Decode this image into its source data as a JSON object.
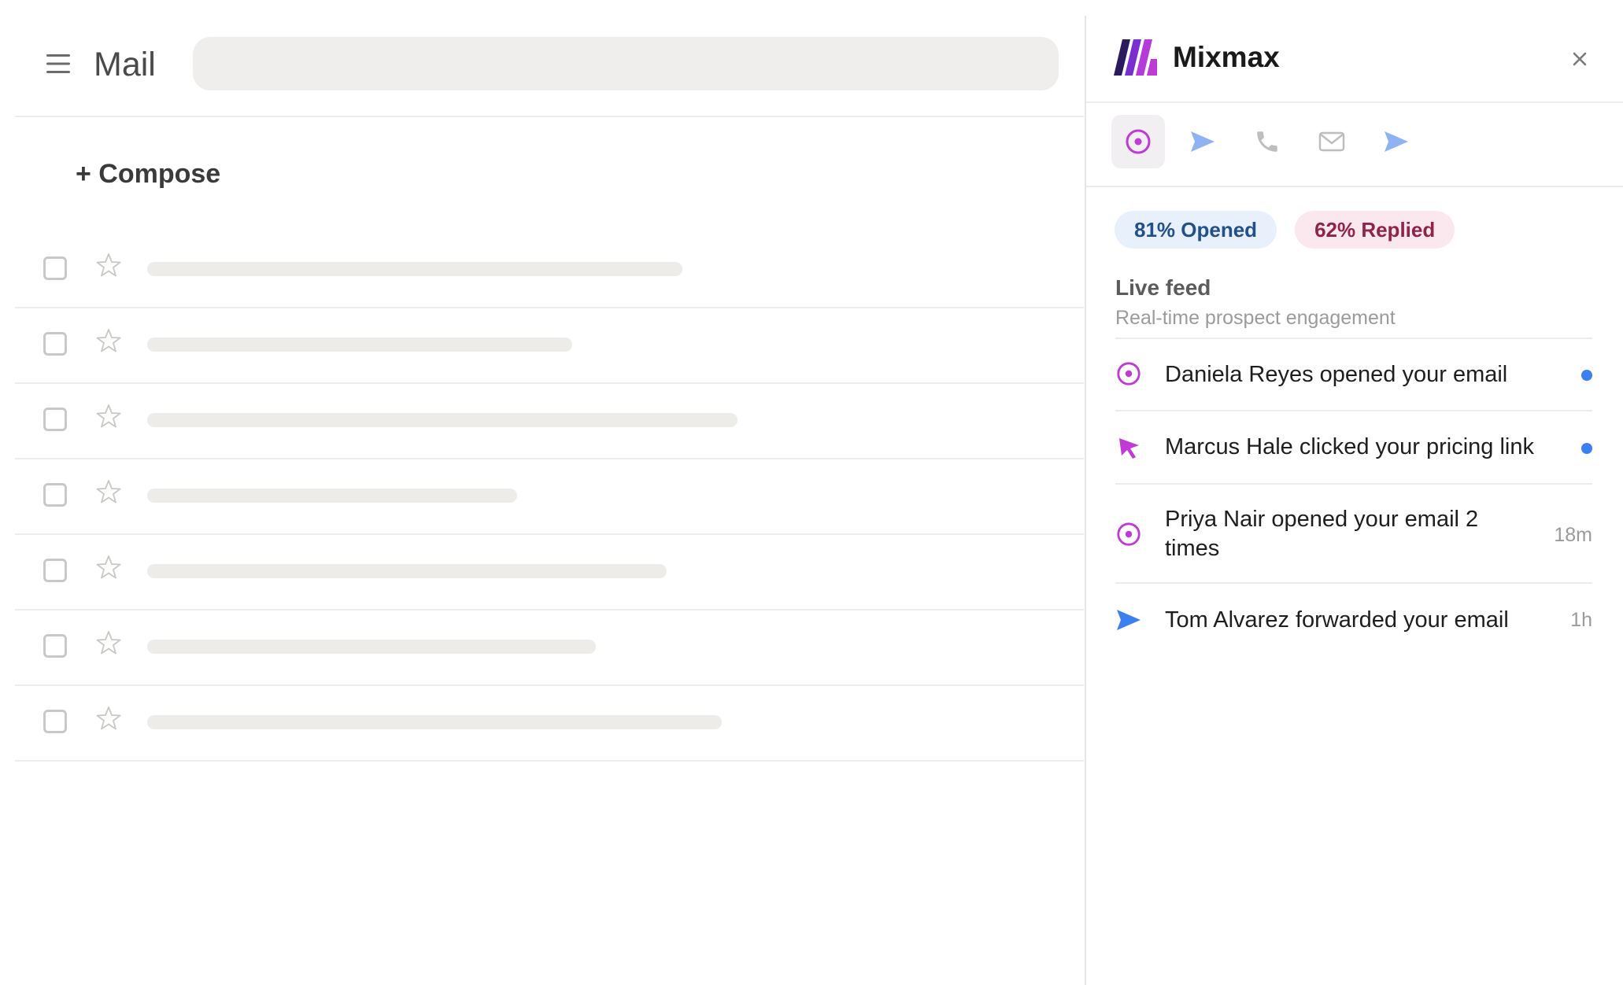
{
  "mail": {
    "title": "Mail",
    "compose_label": "+ Compose",
    "row_count": 7,
    "row_placeholder_widths": [
      0.68,
      0.54,
      0.75,
      0.47,
      0.66,
      0.57,
      0.73
    ]
  },
  "panel": {
    "brand": "Mixmax",
    "logo_colors": [
      "#2b1a5e",
      "#b43bd9"
    ],
    "tabs": [
      {
        "name": "tab-opens",
        "icon": "target-icon",
        "active": true
      },
      {
        "name": "tab-sequences",
        "icon": "send-icon",
        "active": false
      },
      {
        "name": "tab-calls",
        "icon": "phone-icon",
        "active": false
      },
      {
        "name": "tab-messages",
        "icon": "mail-icon",
        "active": false
      },
      {
        "name": "tab-send",
        "icon": "send-icon",
        "active": false
      }
    ],
    "stats": {
      "opened": "81% Opened",
      "replied": "62% Replied"
    },
    "feed": {
      "title": "Live feed",
      "subtitle": "Real-time prospect engagement",
      "items": [
        {
          "icon": "target-icon",
          "text": "Daniela Reyes opened your email",
          "unread": true,
          "time": ""
        },
        {
          "icon": "cursor-click-icon",
          "text": "Marcus Hale clicked your pricing link",
          "unread": true,
          "time": ""
        },
        {
          "icon": "target-icon",
          "text": "Priya Nair opened your email 2 times",
          "unread": false,
          "time": "18m"
        },
        {
          "icon": "send-icon",
          "text": "Tom Alvarez forwarded your email",
          "unread": false,
          "time": "1h"
        }
      ]
    }
  },
  "colors": {
    "accent_purple": "#c03ad6",
    "accent_blue": "#3b7ff0",
    "muted_blue": "#8fb3f2"
  }
}
